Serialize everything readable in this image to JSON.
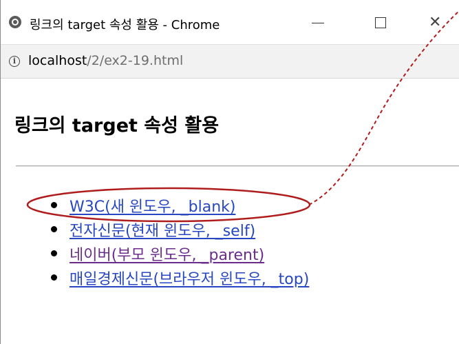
{
  "window": {
    "title": "링크의 target 속성 활용 - Chrome",
    "minimize_symbol": "—",
    "maximize_symbol": "☐",
    "close_symbol": "✕"
  },
  "address": {
    "info_symbol": "i",
    "host": "localhost",
    "path": "/2/ex2-19.html"
  },
  "page": {
    "heading": "링크의 target 속성 활용",
    "links": [
      {
        "label": "W3C(새 윈도우, _blank)",
        "state": "unvisited",
        "color": "#2747c2"
      },
      {
        "label": "전자신문(현재 윈도우, _self)",
        "state": "unvisited",
        "color": "#2747c2"
      },
      {
        "label": "네이버(부모 윈도우, _parent)",
        "state": "visited",
        "color": "#6b2c8e"
      },
      {
        "label": "매일경제신문(브라우저 윈도우, _top)",
        "state": "unvisited",
        "color": "#2747c2"
      }
    ]
  },
  "annotation": {
    "ellipse_color": "#b01c1c",
    "dashed_line_color": "#b01c1c"
  }
}
